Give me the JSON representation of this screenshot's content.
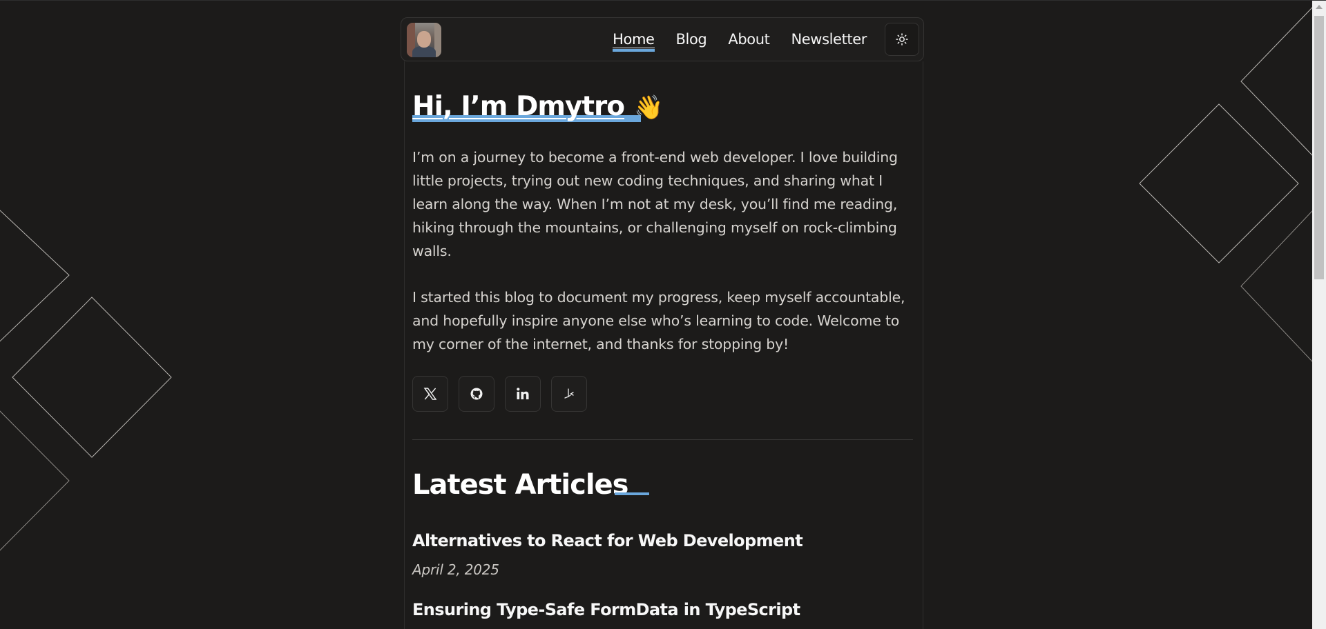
{
  "header": {
    "avatar_alt": "Dmytro avatar",
    "nav": [
      {
        "label": "Home",
        "active": true
      },
      {
        "label": "Blog",
        "active": false
      },
      {
        "label": "About",
        "active": false
      },
      {
        "label": "Newsletter",
        "active": false
      }
    ],
    "theme_toggle_icon": "sun-icon"
  },
  "hero": {
    "title": "Hi, I’m Dmytro",
    "emoji": "👋",
    "paragraphs": [
      "I’m on a journey to become a front-end web developer. I love building little projects, trying out new coding techniques, and sharing what I learn along the way. When I’m not at my desk, you’ll find me reading, hiking through the mountains, or challenging myself on rock-climbing walls.",
      "I started this blog to document my progress, keep myself accountable, and hopefully inspire anyone else who’s learning to code. Welcome to my corner of the internet, and thanks for stopping by!"
    ],
    "socials": [
      {
        "icon": "x-icon"
      },
      {
        "icon": "github-icon"
      },
      {
        "icon": "linkedin-icon"
      },
      {
        "icon": "daily-dev-icon"
      }
    ]
  },
  "articles": {
    "heading": "Latest Articles",
    "items": [
      {
        "title": "Alternatives to React for Web Development",
        "date": "April 2, 2025"
      },
      {
        "title": "Ensuring Type-Safe FormData in TypeScript",
        "date": ""
      }
    ]
  },
  "colors": {
    "background": "#1c1b1a",
    "accent": "#6aa7dc",
    "text": "#f2f2f2",
    "muted_text": "#d6d3cf"
  }
}
